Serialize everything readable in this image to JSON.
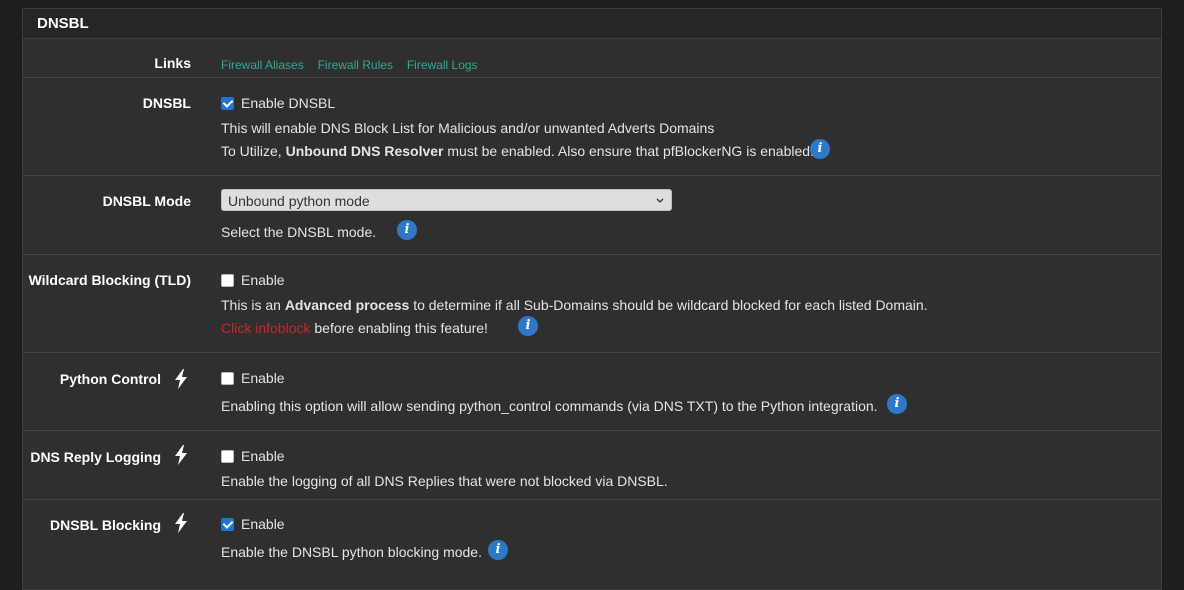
{
  "panel": {
    "title": "DNSBL"
  },
  "links_row": {
    "label": "Links",
    "links": [
      "Firewall Aliases",
      "Firewall Rules",
      "Firewall Logs"
    ]
  },
  "dnsbl_row": {
    "label": "DNSBL",
    "checkbox_label": "Enable DNSBL",
    "checked": true,
    "desc1": "This will enable DNS Block List for Malicious and/or unwanted Adverts Domains",
    "desc2_pre": "To Utilize, ",
    "desc2_bold": "Unbound DNS Resolver",
    "desc2_post": " must be enabled. Also ensure that pfBlockerNG is enabled."
  },
  "mode_row": {
    "label": "DNSBL Mode",
    "selected": "Unbound python mode",
    "desc": "Select the DNSBL mode."
  },
  "wildcard_row": {
    "label": "Wildcard Blocking (TLD)",
    "checkbox_label": "Enable",
    "checked": false,
    "desc1_pre": "This is an ",
    "desc1_bold": "Advanced process",
    "desc1_post": " to determine if all Sub-Domains should be wildcard blocked for each listed Domain.",
    "desc2_red": "Click infoblock",
    "desc2_post": " before enabling this feature!"
  },
  "python_row": {
    "label": "Python Control",
    "checkbox_label": "Enable",
    "checked": false,
    "desc": "Enabling this option will allow sending python_control commands (via DNS TXT) to the Python integration."
  },
  "reply_row": {
    "label": "DNS Reply Logging",
    "checkbox_label": "Enable",
    "checked": false,
    "desc": "Enable the logging of all DNS Replies that were not blocked via DNSBL."
  },
  "blocking_row": {
    "label": "DNSBL Blocking",
    "checkbox_label": "Enable",
    "checked": true,
    "desc": "Enable the DNSBL python blocking mode."
  },
  "colors": {
    "accent": "#1f76d2",
    "link": "#34a891",
    "warning": "#c9262f",
    "info": "#2d79c7"
  },
  "icons": {
    "info": "info-icon",
    "bolt": "bolt-icon",
    "chevron": "chevron-down-icon"
  }
}
